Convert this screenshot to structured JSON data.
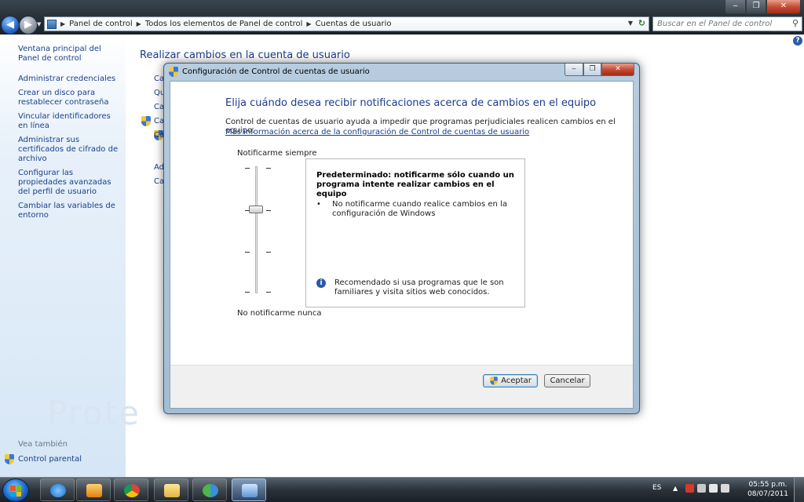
{
  "explorer": {
    "breadcrumb": [
      "Panel de control",
      "Todos los elementos de Panel de control",
      "Cuentas de usuario"
    ],
    "search_placeholder": "Buscar en el Panel de control",
    "left_nav": [
      "Ventana principal del Panel de control",
      "Administrar credenciales",
      "Crear un disco para restablecer contraseña",
      "Vincular identificadores en línea",
      "Administrar sus certificados de cifrado de archivo",
      "Configurar las propiedades avanzadas del perfil de usuario",
      "Cambiar las variables de entorno"
    ],
    "see_also_heading": "Vea también",
    "see_also_item": "Control parental",
    "main_title": "Realizar cambios en la cuenta de usuario",
    "partial_links": [
      "Ca",
      "Qu",
      "Ca",
      "Ca",
      "Ca",
      "Ad",
      "Ca"
    ],
    "watermark": "Prote"
  },
  "dialog": {
    "title": "Configuración de Control de cuentas de usuario",
    "heading": "Elija cuándo desea recibir notificaciones acerca de cambios en el equipo",
    "description": "Control de cuentas de usuario ayuda a impedir que programas perjudiciales realicen cambios en el equipo.",
    "more_link": "Más información acerca de la configuración de Control de cuentas de usuario",
    "slider_top_label": "Notificarme siempre",
    "slider_bottom_label": "No notificarme nunca",
    "slider_level_from_bottom": 3,
    "slider_levels": 4,
    "info_title": "Predeterminado: notificarme sólo cuando un programa intente realizar cambios en el equipo",
    "info_bullet": "No notificarme cuando realice cambios en la configuración de Windows",
    "info_recommendation": "Recomendado si usa programas que le son familiares y visita sitios web conocidos.",
    "ok_label": "Aceptar",
    "cancel_label": "Cancelar"
  },
  "taskbar": {
    "language": "ES",
    "time": "05:55 p.m.",
    "date": "08/07/2011"
  }
}
